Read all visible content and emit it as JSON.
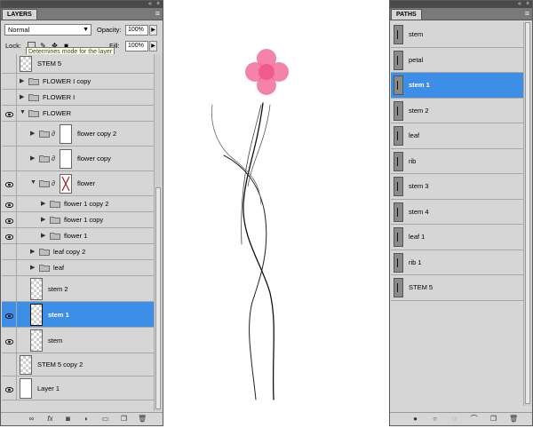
{
  "layers_panel": {
    "tab_label": "LAYERS",
    "blend_mode": "Normal",
    "opacity_label": "Opacity:",
    "opacity_value": "100%",
    "lock_label": "Lock:",
    "fill_label": "Fill:",
    "fill_value": "100%",
    "tooltip": "Determines mode for the layer",
    "layers": [
      {
        "name": "STEM 5",
        "kind": "layer",
        "indent": 0,
        "visible": false,
        "thumb": "checker",
        "selected": false
      },
      {
        "name": "FLOWER I copy",
        "kind": "folder",
        "indent": 0,
        "visible": false,
        "expanded": false,
        "selected": false
      },
      {
        "name": "FLOWER I",
        "kind": "folder",
        "indent": 0,
        "visible": false,
        "expanded": false,
        "selected": false
      },
      {
        "name": "FLOWER",
        "kind": "folder",
        "indent": 0,
        "visible": true,
        "expanded": true,
        "selected": false
      },
      {
        "name": "flower copy 2",
        "kind": "maskfolder",
        "indent": 1,
        "visible": false,
        "expanded": false,
        "selected": false
      },
      {
        "name": "flower copy",
        "kind": "maskfolder",
        "indent": 1,
        "visible": false,
        "expanded": false,
        "selected": false
      },
      {
        "name": "flower",
        "kind": "maskfolder",
        "indent": 1,
        "visible": true,
        "expanded": true,
        "selected": false
      },
      {
        "name": "flower 1 copy 2",
        "kind": "folder",
        "indent": 2,
        "visible": true,
        "expanded": false,
        "selected": false
      },
      {
        "name": "flower 1 copy",
        "kind": "folder",
        "indent": 2,
        "visible": true,
        "expanded": false,
        "selected": false
      },
      {
        "name": "flower 1",
        "kind": "folder",
        "indent": 2,
        "visible": true,
        "expanded": false,
        "selected": false
      },
      {
        "name": "leaf copy 2",
        "kind": "folder",
        "indent": 1,
        "visible": false,
        "expanded": false,
        "selected": false
      },
      {
        "name": "leaf",
        "kind": "folder",
        "indent": 1,
        "visible": false,
        "expanded": false,
        "selected": false
      },
      {
        "name": "stem 2",
        "kind": "layer",
        "indent": 1,
        "visible": false,
        "thumb": "checker",
        "selected": false
      },
      {
        "name": "stem 1",
        "kind": "layer",
        "indent": 1,
        "visible": true,
        "thumb": "checker",
        "selected": true
      },
      {
        "name": "stem",
        "kind": "layer",
        "indent": 1,
        "visible": true,
        "thumb": "checker",
        "selected": false
      },
      {
        "name": "STEM 5 copy 2",
        "kind": "layer",
        "indent": 0,
        "visible": false,
        "thumb": "checker",
        "selected": false
      },
      {
        "name": "Layer 1",
        "kind": "layer",
        "indent": 0,
        "visible": true,
        "thumb": "white",
        "selected": false
      }
    ],
    "footer_icons": [
      "link-icon",
      "fx-icon",
      "add-mask-icon",
      "adjustment-layer-icon",
      "new-group-icon",
      "new-layer-icon",
      "delete-layer-icon"
    ]
  },
  "paths_panel": {
    "tab_label": "PATHS",
    "paths": [
      {
        "name": "stem",
        "selected": false
      },
      {
        "name": "petal",
        "selected": false
      },
      {
        "name": "stem 1",
        "selected": true
      },
      {
        "name": "stem 2",
        "selected": false
      },
      {
        "name": "leaf",
        "selected": false
      },
      {
        "name": "rib",
        "selected": false
      },
      {
        "name": "stem 3",
        "selected": false
      },
      {
        "name": "stem 4",
        "selected": false
      },
      {
        "name": "leaf 1",
        "selected": false
      },
      {
        "name": "rib 1",
        "selected": false
      },
      {
        "name": "STEM 5",
        "selected": false
      }
    ],
    "footer_icons": [
      "fill-path-icon",
      "stroke-path-icon",
      "load-selection-icon",
      "make-work-path-icon",
      "new-path-icon",
      "delete-path-icon"
    ]
  },
  "colors": {
    "selection": "#3d8ee6",
    "petal": "#f36c9a",
    "panel_bg": "#d6d6d6"
  }
}
